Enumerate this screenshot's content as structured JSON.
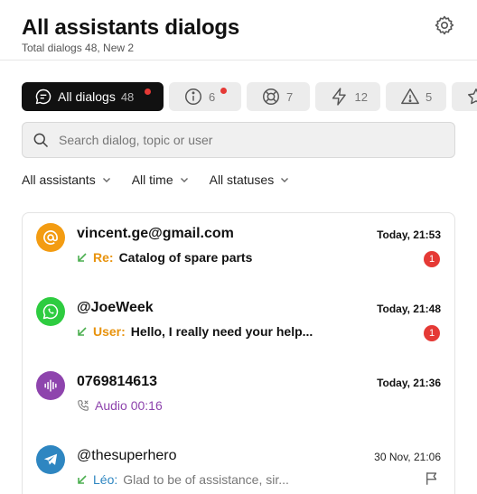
{
  "header": {
    "title": "All assistants dialogs",
    "subtitle": "Total dialogs 48, New 2"
  },
  "tabs": [
    {
      "label": "All dialogs",
      "count": "48",
      "icon": "chat-bubble-icon",
      "active": true,
      "unread_dot": true
    },
    {
      "label": "",
      "count": "6",
      "icon": "info-icon",
      "active": false,
      "unread_dot": true
    },
    {
      "label": "",
      "count": "7",
      "icon": "lifebuoy-icon",
      "active": false,
      "unread_dot": false
    },
    {
      "label": "",
      "count": "12",
      "icon": "lightning-icon",
      "active": false,
      "unread_dot": false
    },
    {
      "label": "",
      "count": "5",
      "icon": "warning-icon",
      "active": false,
      "unread_dot": false
    },
    {
      "label": "",
      "count": "",
      "icon": "star-icon",
      "active": false,
      "unread_dot": false
    }
  ],
  "search": {
    "placeholder": "Search dialog, topic or user"
  },
  "filters": {
    "assistants": "All assistants",
    "time": "All time",
    "statuses": "All statuses"
  },
  "dialogs": [
    {
      "channel": "email",
      "avatar_color": "#f39c12",
      "name": "vincent.ge@gmail.com",
      "time": "Today, 21:53",
      "prefix": "Re:",
      "message": "Catalog of spare parts",
      "unread": "1"
    },
    {
      "channel": "whatsapp",
      "avatar_color": "#2ecc40",
      "name": "@JoeWeek",
      "time": "Today, 21:48",
      "prefix": "User:",
      "message": "Hello, I really need your help...",
      "unread": "1"
    },
    {
      "channel": "voice",
      "avatar_color": "#8e44ad",
      "name": "0769814613",
      "time": "Today, 21:36",
      "prefix": "",
      "message": "Audio 00:16",
      "unread": ""
    },
    {
      "channel": "telegram",
      "avatar_color": "#2e86c1",
      "name": "@thesuperhero",
      "time": "30 Nov, 21:06",
      "prefix": "Léo:",
      "message": "Glad to be of assistance, sir...",
      "unread": ""
    }
  ],
  "colors": {
    "accent_dark": "#111111",
    "alert_red": "#e53935",
    "incoming_green": "#4caf50"
  }
}
